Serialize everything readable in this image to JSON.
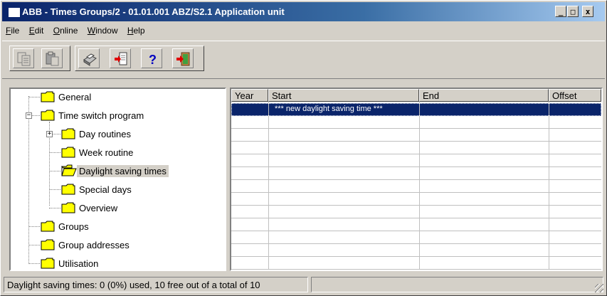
{
  "window": {
    "title": "ABB - Times Groups/2 - 01.01.001 ABZ/S2.1 Application unit",
    "min_glyph": "_",
    "max_glyph": "□",
    "close_glyph": "x"
  },
  "menu": [
    {
      "label": "File",
      "mnemonic": "F",
      "rest": "ile"
    },
    {
      "label": "Edit",
      "mnemonic": "E",
      "rest": "dit"
    },
    {
      "label": "Online",
      "mnemonic": "O",
      "rest": "nline"
    },
    {
      "label": "Window",
      "mnemonic": "W",
      "rest": "indow"
    },
    {
      "label": "Help",
      "mnemonic": "H",
      "rest": "elp"
    }
  ],
  "toolbar": {
    "buttons": [
      "copy-icon",
      "paste-icon",
      "print-icon",
      "import-icon",
      "help-icon",
      "exit-icon"
    ],
    "help_glyph": "?"
  },
  "tree": {
    "items": [
      {
        "label": "General"
      },
      {
        "label": "Time switch program",
        "expander": "−"
      },
      {
        "label": "Day routines",
        "expander": "+"
      },
      {
        "label": "Week routine"
      },
      {
        "label": "Daylight saving times",
        "selected": true
      },
      {
        "label": "Special days"
      },
      {
        "label": "Overview"
      },
      {
        "label": "Groups"
      },
      {
        "label": "Group addresses"
      },
      {
        "label": "Utilisation"
      }
    ]
  },
  "grid": {
    "columns": [
      "Year",
      "Start",
      "End",
      "Offset"
    ],
    "rows": [
      {
        "start": "*** new daylight saving time ***"
      }
    ]
  },
  "status": {
    "text": "Daylight saving times: 0 (0%) used, 10 free out of a total of 10"
  },
  "colors": {
    "title_bar": "#0a246a",
    "selection": "#0a246a",
    "face": "#d4d0c8",
    "folder": "#ffff00"
  }
}
